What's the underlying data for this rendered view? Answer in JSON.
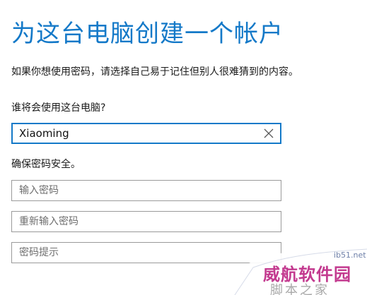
{
  "page": {
    "title": "为这台电脑创建一个帐户",
    "description": "如果你想使用密码，请选择自己易于记住但别人很难猜到的内容。"
  },
  "user_section": {
    "label": "谁将会使用这台电脑?",
    "username_value": "Xiaoming"
  },
  "password_section": {
    "label": "确保密码安全。",
    "password_placeholder": "输入密码",
    "confirm_placeholder": "重新输入密码",
    "hint_placeholder": "密码提示"
  },
  "icons": {
    "clear": "close-icon"
  },
  "colors": {
    "accent": "#1479c8",
    "border": "#9a9a9a",
    "watermark": "#c33a8f"
  },
  "watermark": {
    "site": "ib51.net",
    "brand": "威航软件园",
    "sub": "脚本之家"
  }
}
